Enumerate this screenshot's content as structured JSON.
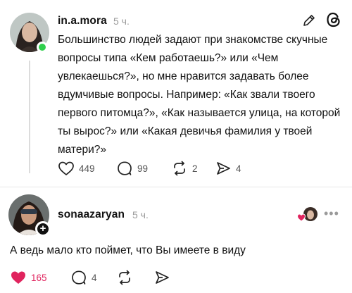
{
  "post": {
    "username": "in.a.mora",
    "time": "5 ч.",
    "text": "Большинство людей задают при знакомстве скучные вопросы типа «Кем работаешь?» или «Чем увлекаешься?», но мне нравится задавать более вдумчивые вопросы. Например: «Как звали твоего первого питомца?», «Как называется улица, на которой ты вырос?» или «Какая девичья фамилия у твоей матери?»",
    "likes": "449",
    "replies": "99",
    "reposts": "2",
    "shares": "4",
    "online_color": "#2fcf4c"
  },
  "reply": {
    "username": "sonaazaryan",
    "time": "5 ч.",
    "text": "А ведь мало кто поймет, что Вы имеете в виду",
    "likes": "165",
    "replies": "4",
    "like_color": "#e0245e"
  },
  "icons": {
    "edit": "pencil-icon",
    "threads": "threads-logo-icon",
    "like": "heart-icon",
    "reply": "speech-bubble-icon",
    "repost": "repost-icon",
    "share": "send-icon",
    "more": "more-dots-icon",
    "follow": "plus-icon"
  }
}
